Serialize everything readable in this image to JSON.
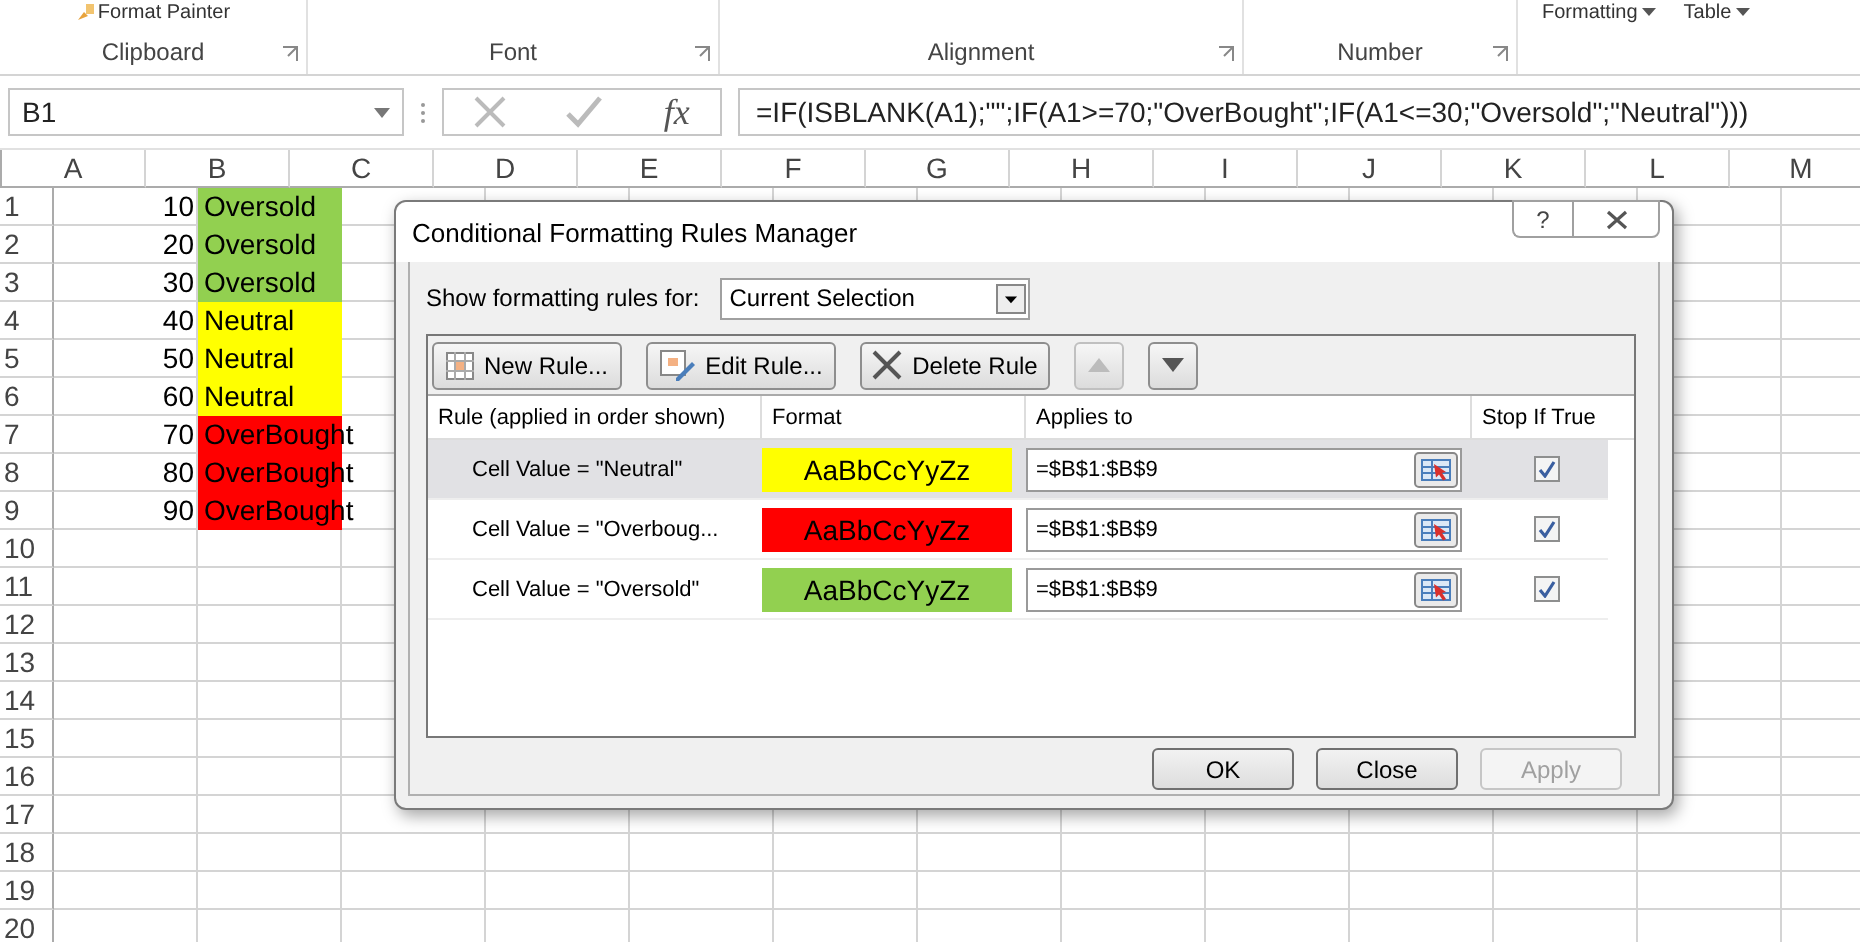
{
  "ribbon": {
    "format_painter": "Format Painter",
    "style_buttons": [
      "Formatting",
      "Table"
    ],
    "groups": [
      "Clipboard",
      "Font",
      "Alignment",
      "Number"
    ]
  },
  "formula_bar": {
    "name_box": "B1",
    "fx": "fx",
    "formula": "=IF(ISBLANK(A1);\"\";IF(A1>=70;\"OverBought\";IF(A1<=30;\"Oversold\";\"Neutral\")))"
  },
  "sheet": {
    "columns": [
      "A",
      "B",
      "C",
      "D",
      "E",
      "F",
      "G",
      "H",
      "I",
      "J",
      "K",
      "L",
      "M"
    ],
    "rows": [
      {
        "number": "1",
        "cells": [
          {
            "text": "10"
          },
          {
            "text": "Oversold",
            "color": "#92d050"
          }
        ]
      },
      {
        "number": "2",
        "cells": [
          {
            "text": "20"
          },
          {
            "text": "Oversold",
            "color": "#92d050"
          }
        ]
      },
      {
        "number": "3",
        "cells": [
          {
            "text": "30"
          },
          {
            "text": "Oversold",
            "color": "#92d050"
          }
        ]
      },
      {
        "number": "4",
        "cells": [
          {
            "text": "40"
          },
          {
            "text": "Neutral",
            "color": "#ffff00"
          }
        ]
      },
      {
        "number": "5",
        "cells": [
          {
            "text": "50"
          },
          {
            "text": "Neutral",
            "color": "#ffff00"
          }
        ]
      },
      {
        "number": "6",
        "cells": [
          {
            "text": "60"
          },
          {
            "text": "Neutral",
            "color": "#ffff00"
          }
        ]
      },
      {
        "number": "7",
        "cells": [
          {
            "text": "70"
          },
          {
            "text": "OverBought",
            "color": "#ff0000"
          }
        ]
      },
      {
        "number": "8",
        "cells": [
          {
            "text": "80"
          },
          {
            "text": "OverBought",
            "color": "#ff0000"
          }
        ]
      },
      {
        "number": "9",
        "cells": [
          {
            "text": "90"
          },
          {
            "text": "OverBought",
            "color": "#ff0000"
          }
        ]
      },
      {
        "number": "10",
        "cells": []
      },
      {
        "number": "11",
        "cells": []
      },
      {
        "number": "12",
        "cells": []
      },
      {
        "number": "13",
        "cells": []
      },
      {
        "number": "14",
        "cells": []
      },
      {
        "number": "15",
        "cells": []
      },
      {
        "number": "16",
        "cells": []
      },
      {
        "number": "17",
        "cells": []
      },
      {
        "number": "18",
        "cells": []
      },
      {
        "number": "19",
        "cells": []
      },
      {
        "number": "20",
        "cells": []
      }
    ]
  },
  "dialog": {
    "title": "Conditional Formatting Rules Manager",
    "help": "?",
    "show_label": "Show formatting rules for:",
    "show_value": "Current Selection",
    "toolbar": [
      {
        "kind": "new",
        "label": "New Rule...",
        "disabled": false
      },
      {
        "kind": "edit",
        "label": "Edit Rule...",
        "disabled": false
      },
      {
        "kind": "delete",
        "label": "Delete Rule",
        "disabled": false
      },
      {
        "kind": "up",
        "disabled": true
      },
      {
        "kind": "down",
        "disabled": false
      }
    ],
    "columns": [
      "Rule (applied in order shown)",
      "Format",
      "Applies to",
      "Stop If True"
    ],
    "rules": [
      {
        "rule": "Cell Value = \"Neutral\"",
        "preview": "AaBbCcYyZz",
        "color": "#ffff00",
        "applies_to": "=$B$1:$B$9",
        "stop_if_true": true,
        "selected": true
      },
      {
        "rule": "Cell Value = \"Overboug...",
        "preview": "AaBbCcYyZz",
        "color": "#ff0000",
        "applies_to": "=$B$1:$B$9",
        "stop_if_true": true,
        "selected": false
      },
      {
        "rule": "Cell Value = \"Oversold\"",
        "preview": "AaBbCcYyZz",
        "color": "#92d050",
        "applies_to": "=$B$1:$B$9",
        "stop_if_true": true,
        "selected": false
      }
    ],
    "buttons": [
      {
        "label": "OK",
        "disabled": false
      },
      {
        "label": "Close",
        "disabled": false
      },
      {
        "label": "Apply",
        "disabled": true
      }
    ]
  }
}
